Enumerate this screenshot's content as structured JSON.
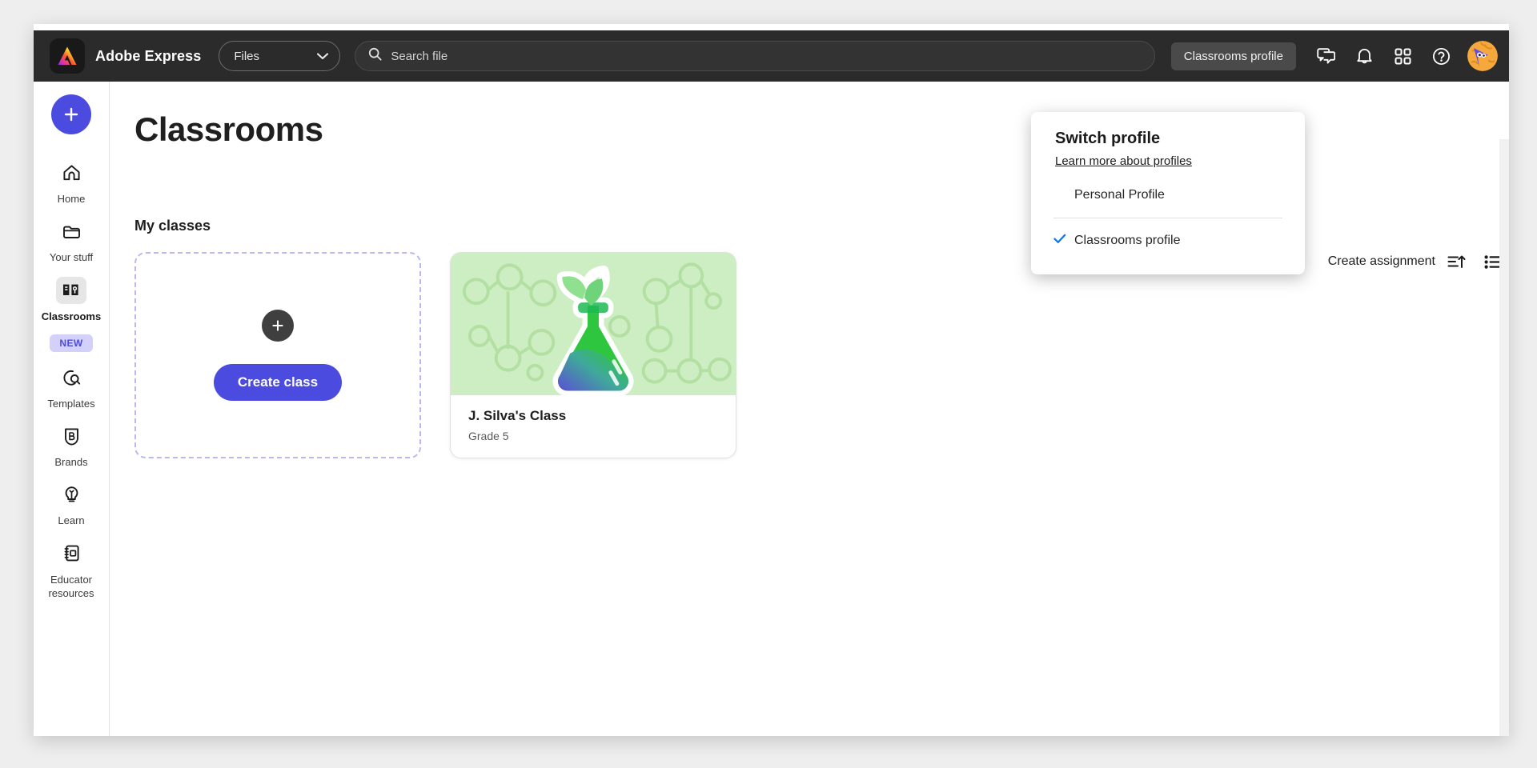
{
  "app": {
    "brand_name": "Adobe Express",
    "logo_icon": "adobe-express-logo"
  },
  "topbar": {
    "scope_select": {
      "value": "Files",
      "chevron_icon": "chevron-down-icon"
    },
    "search": {
      "placeholder": "Search file",
      "icon": "search-icon"
    },
    "profile_chip_label": "Classrooms profile",
    "icons": [
      {
        "name": "chat-icon",
        "glyph": "chat"
      },
      {
        "name": "bell-icon",
        "glyph": "bell"
      },
      {
        "name": "apps-grid-icon",
        "glyph": "grid"
      },
      {
        "name": "help-icon",
        "glyph": "question"
      }
    ],
    "avatar_name": "user-avatar"
  },
  "sidebar": {
    "create_button_label": "+",
    "items": [
      {
        "label": "Home",
        "icon": "home-icon",
        "active": false,
        "badge": null
      },
      {
        "label": "Your stuff",
        "icon": "folder-icon",
        "active": false,
        "badge": null
      },
      {
        "label": "Classrooms",
        "icon": "classrooms-icon",
        "active": true,
        "badge": "NEW"
      },
      {
        "label": "Templates",
        "icon": "templates-search-icon",
        "active": false,
        "badge": null
      },
      {
        "label": "Brands",
        "icon": "brands-shield-icon",
        "active": false,
        "badge": null
      },
      {
        "label": "Learn",
        "icon": "lightbulb-icon",
        "active": false,
        "badge": null
      },
      {
        "label": "Educator resources",
        "icon": "notebook-icon",
        "active": false,
        "badge": null
      }
    ]
  },
  "main": {
    "page_title": "Classrooms",
    "toolbar": {
      "create_assignment_label": "Create assignment",
      "sort_icon": "sort-ascending-icon",
      "view_list_icon": "list-view-icon"
    },
    "section_title": "My classes",
    "create_card": {
      "plus_icon": "plus-icon",
      "button_label": "Create class"
    },
    "classes": [
      {
        "name": "J. Silva's Class",
        "grade": "Grade 5",
        "thumbnail_icon": "science-flask-plant-icon",
        "thumbnail_bg": "#cdeec2"
      }
    ]
  },
  "profile_dropdown": {
    "title": "Switch profile",
    "link_label": "Learn more about profiles",
    "options": [
      {
        "label": "Personal Profile",
        "selected": false
      },
      {
        "label": "Classrooms profile",
        "selected": true
      }
    ],
    "check_icon": "check-icon"
  },
  "colors": {
    "accent_indigo": "#4b4be0",
    "topbar_dark": "#2b2b2b",
    "badge_bg": "#d3d1fa",
    "check_blue": "#1473e6",
    "card_green": "#cdeec2"
  }
}
